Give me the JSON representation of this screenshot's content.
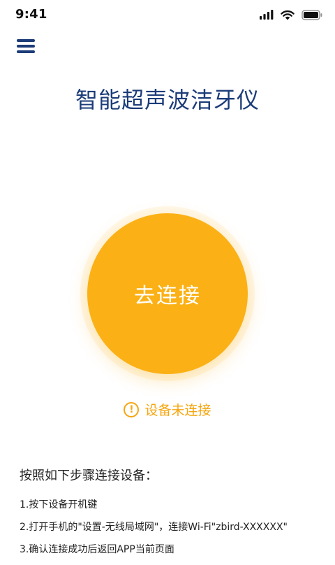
{
  "status_bar": {
    "time": "9:41",
    "icons": [
      "signal-icon",
      "wifi-icon",
      "battery-icon"
    ]
  },
  "header": {
    "menu_icon": "hamburger-menu-icon",
    "title": "智能超声波洁牙仪"
  },
  "main": {
    "connect_button_label": "去连接",
    "status_text": "设备未连接",
    "status_icon": "alert-circle-icon"
  },
  "instructions": {
    "heading": "按照如下步骤连接设备：",
    "steps": [
      "1.按下设备开机键",
      "2.打开手机的\"设置-无线局域网\"，连接Wi-Fi\"zbird-XXXXXX\"",
      "3.确认连接成功后返回APP当前页面"
    ]
  },
  "colors": {
    "title_blue": "#1c3c79",
    "accent_orange": "#fbb115",
    "status_orange": "#f5a60f",
    "background": "#ffffff"
  }
}
